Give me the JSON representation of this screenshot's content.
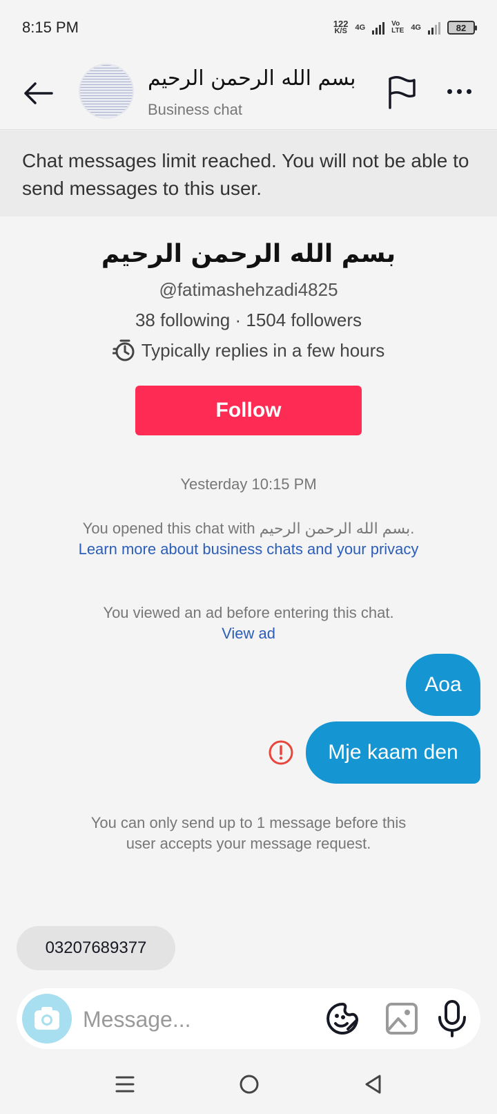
{
  "status_bar": {
    "time": "8:15 PM",
    "net_speed": "122",
    "net_unit": "K/S",
    "net_label_1": "4G",
    "volte_top": "Vo",
    "volte_bottom": "LTE",
    "net_label_2": "4G",
    "battery": "82"
  },
  "header": {
    "title": "بسم الله الرحمن الرحيم",
    "subtitle": "Business chat"
  },
  "limit_banner": {
    "text": "Chat messages limit reached. You will not be able to send messages to this user."
  },
  "profile": {
    "name": "بسم الله الرحمن الرحيم",
    "handle": "@fatimashehzadi4825",
    "stats": "38 following · 1504 followers",
    "reply_time": "Typically replies in a few hours",
    "follow_label": "Follow"
  },
  "chat": {
    "timestamp": "Yesterday 10:15 PM",
    "opened_text": "You opened this chat with بسم الله الرحمن الرحيم.",
    "learn_more_link": "Learn more about business chats and your privacy",
    "ad_text": "You viewed an ad before entering this chat.",
    "view_ad_link": "View ad",
    "messages": [
      {
        "text": "Aoa"
      },
      {
        "text": "Mje kaam den",
        "status": "failed"
      }
    ],
    "limit_notice": "You can only send up to 1 message before this user accepts your message request.",
    "quick_reply": "03207689377"
  },
  "composer": {
    "placeholder": "Message..."
  },
  "colors": {
    "follow": "#fe2c55",
    "bubble": "#1596d2",
    "link": "#2b5db9",
    "error": "#e8453c",
    "camera_bg": "#a7dff0"
  },
  "icons": [
    "back-arrow-icon",
    "flag-icon",
    "more-icon",
    "timer-icon",
    "error-icon",
    "camera-icon",
    "sticker-icon",
    "image-icon",
    "mic-icon"
  ]
}
